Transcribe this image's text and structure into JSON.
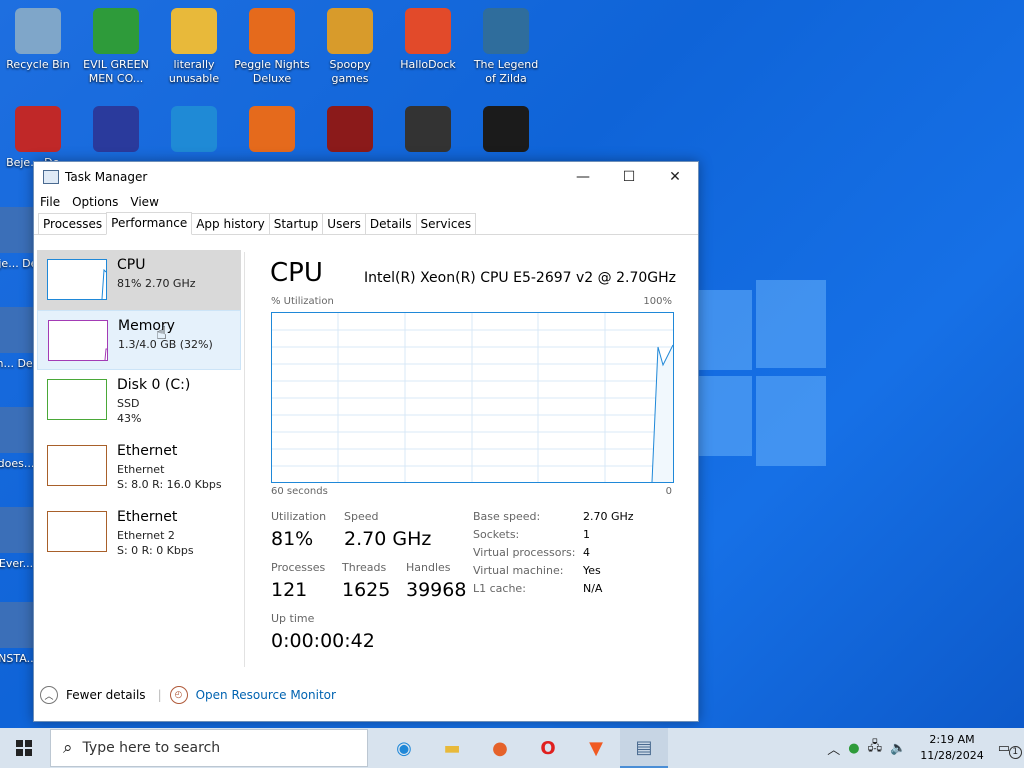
{
  "desktop": {
    "icons_row1": [
      {
        "label": "Recycle Bin",
        "color": "#7fa6c9"
      },
      {
        "label": "EVIL GREEN MEN CO...",
        "color": "#2e9b3a"
      },
      {
        "label": "literally unusable",
        "color": "#e8b93a"
      },
      {
        "label": "Peggle Nights Deluxe",
        "color": "#e56a1c"
      },
      {
        "label": "Spoopy games",
        "color": "#d89b2b"
      },
      {
        "label": "HalloDock",
        "color": "#e24a2a"
      },
      {
        "label": "The Legend of Zilda",
        "color": "#2f6d9c"
      }
    ],
    "icons_row2": [
      {
        "label": "Beje... De...",
        "color": "#c02828"
      },
      {
        "label": "",
        "color": "#2a3a9c"
      },
      {
        "label": "",
        "color": "#1f8ad6"
      },
      {
        "label": "",
        "color": "#e56a1c"
      },
      {
        "label": "",
        "color": "#8b1a1a"
      },
      {
        "label": "",
        "color": "#333333"
      },
      {
        "label": "",
        "color": "#1b1b1b"
      }
    ],
    "left_partial_labels": [
      "Beje... De...",
      "Ch... De...",
      "does...",
      "Ever...",
      "INSTA..."
    ]
  },
  "task_manager": {
    "title": "Task Manager",
    "controls": {
      "minimize": "—",
      "maximize": "☐",
      "close": "✕"
    },
    "menu": [
      "File",
      "Options",
      "View"
    ],
    "tabs": [
      "Processes",
      "Performance",
      "App history",
      "Startup",
      "Users",
      "Details",
      "Services"
    ],
    "resources": [
      {
        "name": "CPU",
        "sub1": "81% 2.70 GHz",
        "sub2": "",
        "color": "#1f88d8"
      },
      {
        "name": "Memory",
        "sub1": "1.3/4.0 GB (32%)",
        "sub2": "",
        "color": "#a33bb5"
      },
      {
        "name": "Disk 0 (C:)",
        "sub1": "SSD",
        "sub2": "43%",
        "color": "#4aa838"
      },
      {
        "name": "Ethernet",
        "sub1": "Ethernet",
        "sub2": "S: 8.0  R: 16.0 Kbps",
        "color": "#a8602a"
      },
      {
        "name": "Ethernet",
        "sub1": "Ethernet 2",
        "sub2": "S: 0  R: 0 Kbps",
        "color": "#a8602a"
      }
    ],
    "detail": {
      "title": "CPU",
      "cpu_name": "Intel(R) Xeon(R) CPU E5-2697 v2 @ 2.70GHz",
      "y_label": "% Utilization",
      "y_max": "100%",
      "x_left": "60 seconds",
      "x_right": "0",
      "utilization_label": "Utilization",
      "utilization": "81%",
      "speed_label": "Speed",
      "speed": "2.70 GHz",
      "processes_label": "Processes",
      "processes": "121",
      "threads_label": "Threads",
      "threads": "1625",
      "handles_label": "Handles",
      "handles": "39968",
      "uptime_label": "Up time",
      "uptime": "0:00:00:42",
      "props": [
        {
          "k": "Base speed:",
          "v": "2.70 GHz"
        },
        {
          "k": "Sockets:",
          "v": "1"
        },
        {
          "k": "Virtual processors:",
          "v": "4"
        },
        {
          "k": "Virtual machine:",
          "v": "Yes"
        },
        {
          "k": "L1 cache:",
          "v": "N/A"
        }
      ]
    },
    "footer": {
      "fewer": "Fewer details",
      "monitor": "Open Resource Monitor"
    }
  },
  "taskbar": {
    "search_placeholder": "Type here to search",
    "time": "2:19 AM",
    "date": "11/28/2024",
    "notification_count": "1"
  }
}
